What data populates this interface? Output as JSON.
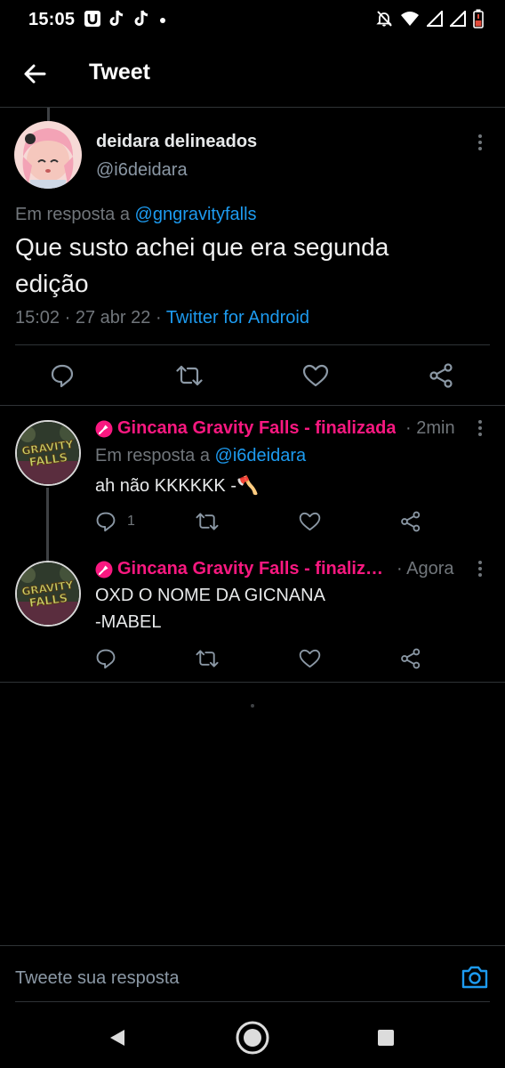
{
  "status_bar": {
    "time": "15:05",
    "left_icons": [
      "u-app-icon",
      "tiktok-icon",
      "tiktok-icon",
      "notification-dot-icon"
    ],
    "right_icons": [
      "mute-icon",
      "wifi-icon",
      "signal-icon",
      "signal-icon",
      "battery-low-icon"
    ]
  },
  "header": {
    "title": "Tweet",
    "back_icon": "arrow-left-icon"
  },
  "main_tweet": {
    "display_name": "deidara delineados",
    "handle": "@i6deidara",
    "reply_prefix": "Em resposta a",
    "reply_mention": "@gngravityfalls",
    "text_line1": "Que susto achei que era segunda",
    "text_line2": "edição",
    "time": "15:02",
    "date": "27 abr 22",
    "separator": "·",
    "source": "Twitter for Android"
  },
  "replies": [
    {
      "badge_icon": "microphone-badge-icon",
      "display_name": "Gincana Gravity Falls - finalizada",
      "separator": "·",
      "time": "2min",
      "reply_prefix": "Em resposta a",
      "reply_mention": "@i6deidara",
      "text": "ah não KKKKKK -🪓",
      "reply_count": "1",
      "avatar_text": "GRAVITY FALLS"
    },
    {
      "badge_icon": "microphone-badge-icon",
      "display_name": "Gincana Gravity Falls - finalizada",
      "separator": "·",
      "time": "Agora",
      "text_line1": "OXD O NOME DA GICNANA",
      "text_line2": "-MABEL",
      "avatar_text": "GRAVITY FALLS"
    }
  ],
  "compose": {
    "placeholder": "Tweete sua resposta"
  },
  "colors": {
    "background": "#000000",
    "accent_blue": "#1d9bf0",
    "accent_pink": "#f91880",
    "muted": "#71767b",
    "divider": "#2f3336"
  }
}
